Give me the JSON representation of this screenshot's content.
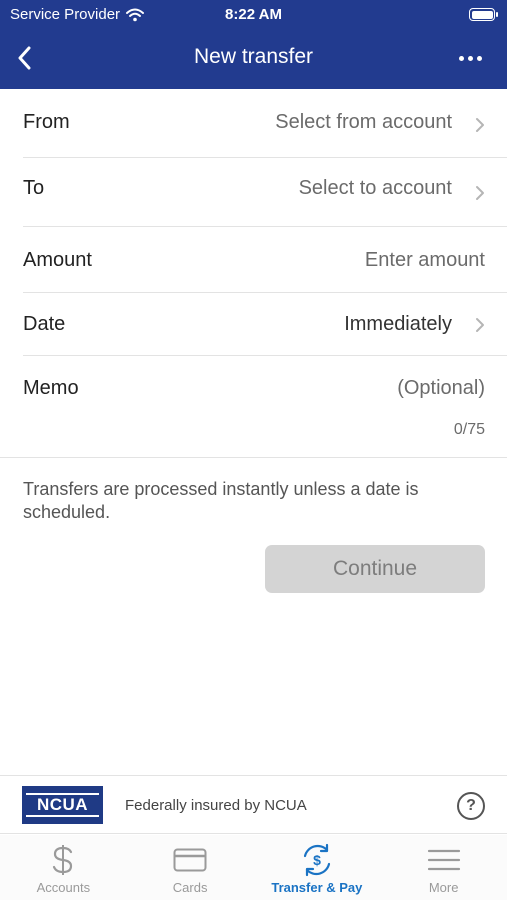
{
  "status_bar": {
    "carrier": "Service Provider",
    "time": "8:22 AM"
  },
  "nav": {
    "title": "New transfer",
    "back_icon": "chevron-left-icon",
    "more_icon": "ellipsis-icon"
  },
  "form": {
    "from": {
      "label": "From",
      "value": "Select from account"
    },
    "to": {
      "label": "To",
      "value": "Select to account"
    },
    "amount": {
      "label": "Amount",
      "placeholder": "Enter amount"
    },
    "date": {
      "label": "Date",
      "value": "Immediately"
    },
    "memo": {
      "label": "Memo",
      "placeholder": "(Optional)",
      "counter": "0/75"
    }
  },
  "info_text": "Transfers are processed instantly unless a date is scheduled.",
  "continue_label": "Continue",
  "ncua": {
    "logo_text": "NCUA",
    "text": "Federally insured by NCUA",
    "help_symbol": "?"
  },
  "tabs": [
    {
      "label": "Accounts",
      "icon": "dollar-icon",
      "active": false
    },
    {
      "label": "Cards",
      "icon": "card-icon",
      "active": false
    },
    {
      "label": "Transfer & Pay",
      "icon": "transfer-pay-icon",
      "active": true
    },
    {
      "label": "More",
      "icon": "menu-icon",
      "active": false
    }
  ],
  "colors": {
    "header": "#223b8f",
    "active_tab": "#1a73c4",
    "button_disabled": "#d4d4d4"
  }
}
